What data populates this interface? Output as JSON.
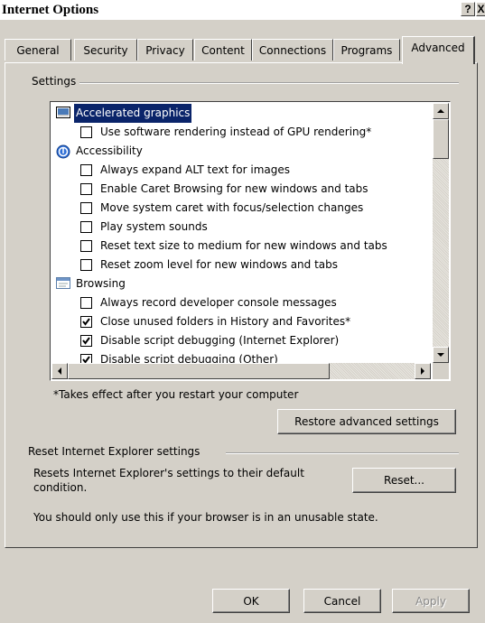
{
  "window": {
    "title": "Internet Options",
    "help_label": "?",
    "close_label": "X"
  },
  "tabs": [
    {
      "label": "General"
    },
    {
      "label": "Security"
    },
    {
      "label": "Privacy"
    },
    {
      "label": "Content"
    },
    {
      "label": "Connections"
    },
    {
      "label": "Programs"
    },
    {
      "label": "Advanced",
      "active": true
    }
  ],
  "settings": {
    "group_label": "Settings",
    "items": [
      {
        "type": "category",
        "icon": "display-icon",
        "label": "Accelerated graphics",
        "selected": true
      },
      {
        "type": "option",
        "label": "Use software rendering instead of GPU rendering*",
        "checked": false
      },
      {
        "type": "category",
        "icon": "accessibility-icon",
        "label": "Accessibility"
      },
      {
        "type": "option",
        "label": "Always expand ALT text for images",
        "checked": false
      },
      {
        "type": "option",
        "label": "Enable Caret Browsing for new windows and tabs",
        "checked": false
      },
      {
        "type": "option",
        "label": "Move system caret with focus/selection changes",
        "checked": false
      },
      {
        "type": "option",
        "label": "Play system sounds",
        "checked": false
      },
      {
        "type": "option",
        "label": "Reset text size to medium for new windows and tabs",
        "checked": false
      },
      {
        "type": "option",
        "label": "Reset zoom level for new windows and tabs",
        "checked": false
      },
      {
        "type": "category",
        "icon": "browsing-icon",
        "label": "Browsing"
      },
      {
        "type": "option",
        "label": "Always record developer console messages",
        "checked": false
      },
      {
        "type": "option",
        "label": "Close unused folders in History and Favorites*",
        "checked": true
      },
      {
        "type": "option",
        "label": "Disable script debugging (Internet Explorer)",
        "checked": true
      },
      {
        "type": "option",
        "label": "Disable script debugging (Other)",
        "checked": true
      }
    ],
    "footnote": "*Takes effect after you restart your computer",
    "restore_label": "Restore advanced settings"
  },
  "reset": {
    "group_label": "Reset Internet Explorer settings",
    "description": "Resets Internet Explorer's settings to their default condition.",
    "reset_label": "Reset...",
    "warning": "You should only use this if your browser is in an unusable state."
  },
  "footer": {
    "ok_label": "OK",
    "cancel_label": "Cancel",
    "apply_label": "Apply",
    "apply_enabled": false
  },
  "colors": {
    "dialog_bg": "#d4d0c8",
    "selection_bg": "#0a246a",
    "selection_fg": "#ffffff"
  }
}
